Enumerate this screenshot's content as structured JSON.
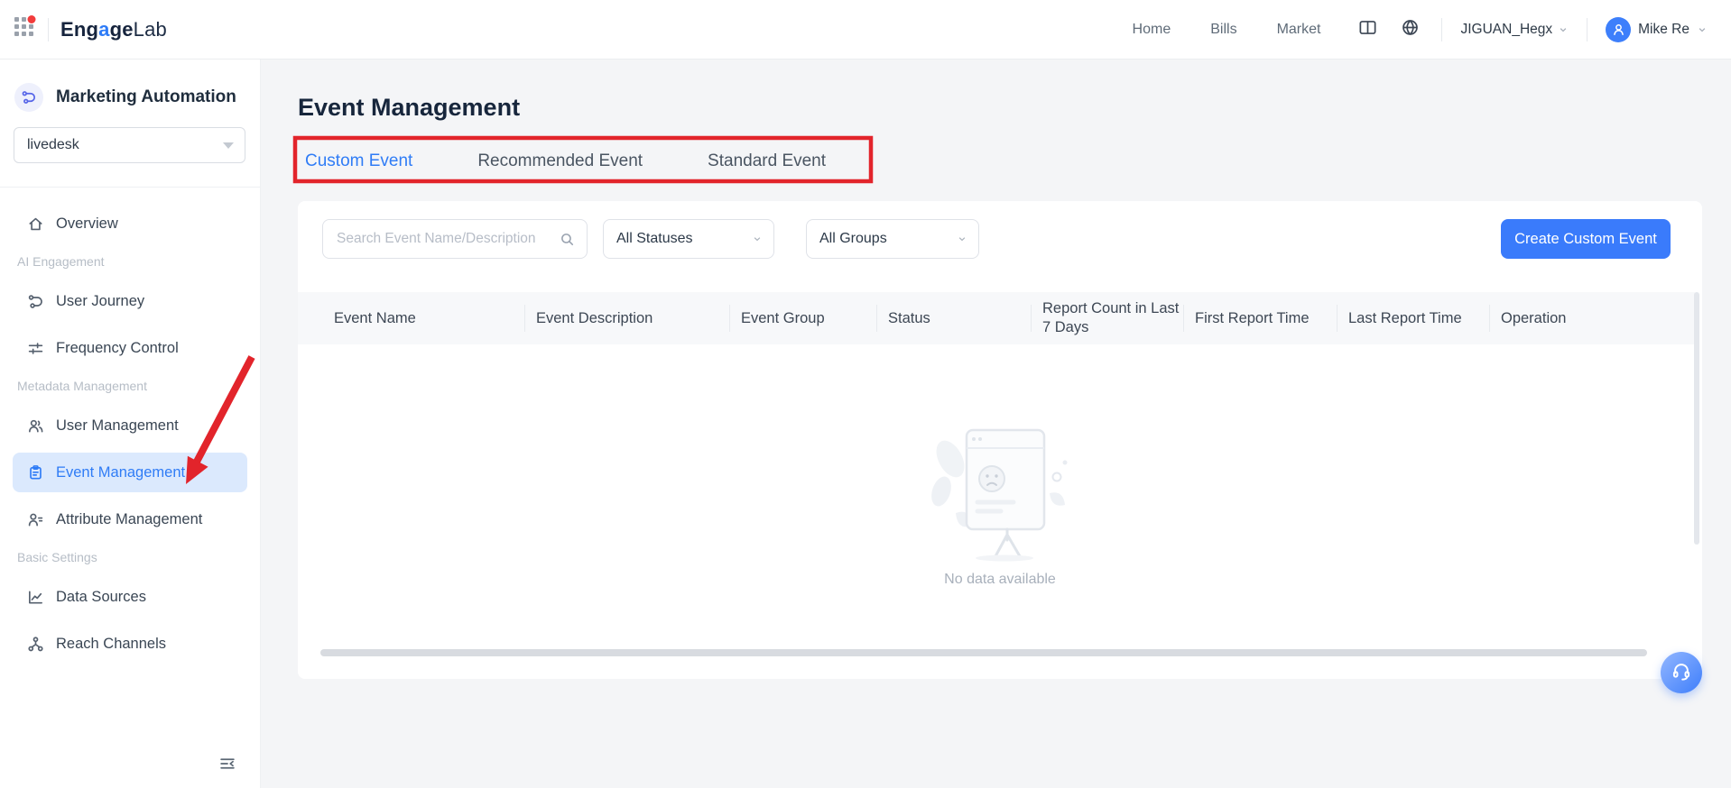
{
  "colors": {
    "accent_blue": "#2f7cf6",
    "button_blue": "#3a7bfb",
    "active_item_bg": "#dbe9fd",
    "annotation_red": "#e2242b",
    "page_bg": "#f4f5f7",
    "title_text": "#17263c"
  },
  "header": {
    "logo": {
      "p1": "Eng",
      "p2": "a",
      "p3": "ge",
      "p4": "Lab"
    },
    "nav": [
      "Home",
      "Bills",
      "Market"
    ],
    "icons": [
      "apps-grid-icon",
      "layout-columns-icon",
      "globe-icon"
    ],
    "org": "JIGUAN_Hegx",
    "user": "Mike Re"
  },
  "sidebar": {
    "product": "Marketing Automation",
    "product_icon": "journey-icon",
    "app_selector_value": "livedesk",
    "items": [
      {
        "type": "link",
        "label": "Overview",
        "icon": "home-icon",
        "active": false
      },
      {
        "type": "section",
        "label": "AI Engagement"
      },
      {
        "type": "link",
        "label": "User Journey",
        "icon": "journey-icon",
        "active": false
      },
      {
        "type": "link",
        "label": "Frequency Control",
        "icon": "sliders-icon",
        "active": false
      },
      {
        "type": "section",
        "label": "Metadata Management"
      },
      {
        "type": "link",
        "label": "User Management",
        "icon": "users-icon",
        "active": false
      },
      {
        "type": "link",
        "label": "Event Management",
        "icon": "clipboard-icon",
        "active": true
      },
      {
        "type": "link",
        "label": "Attribute Management",
        "icon": "attribute-icon",
        "active": false
      },
      {
        "type": "section",
        "label": "Basic Settings"
      },
      {
        "type": "link",
        "label": "Data Sources",
        "icon": "chart-line-icon",
        "active": false
      },
      {
        "type": "link",
        "label": "Reach Channels",
        "icon": "share-nodes-icon",
        "active": false
      }
    ],
    "collapse_icon": "collapse-sidebar-icon"
  },
  "main": {
    "title": "Event Management",
    "tabs": [
      {
        "label": "Custom Event",
        "active": true
      },
      {
        "label": "Recommended Event",
        "active": false
      },
      {
        "label": "Standard Event",
        "active": false
      }
    ],
    "filters": {
      "search_placeholder": "Search Event Name/Description",
      "status_value": "All Statuses",
      "group_value": "All Groups"
    },
    "create_button_label": "Create Custom Event",
    "table": {
      "columns": [
        "Event Name",
        "Event Description",
        "Event Group",
        "Status",
        "Report Count in Last 7 Days",
        "First Report Time",
        "Last Report Time",
        "Operation"
      ],
      "rows": [],
      "empty_text": "No data available"
    },
    "support_icon": "headset-support-icon"
  },
  "annotations": [
    "red-box-around-tabs",
    "red-arrow-to-event-management"
  ]
}
